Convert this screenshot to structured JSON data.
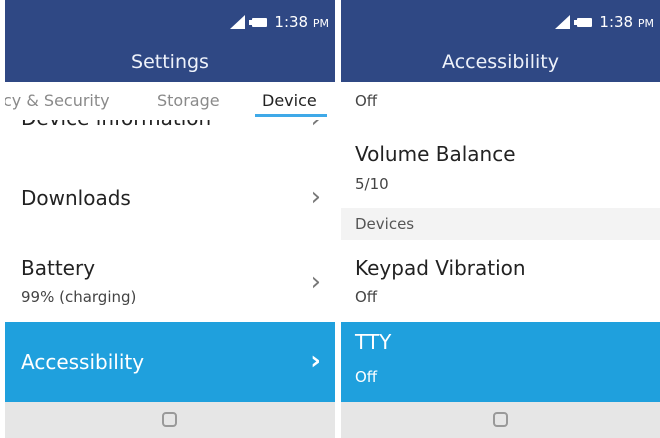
{
  "left": {
    "status": {
      "time": "1:38",
      "ampm": "PM"
    },
    "header": {
      "title": "Settings"
    },
    "tabs": [
      {
        "label": "cy & Security"
      },
      {
        "label": "Storage"
      },
      {
        "label": "Device"
      }
    ],
    "items": [
      {
        "title": "Device information"
      },
      {
        "title": "Downloads"
      },
      {
        "title": "Battery",
        "sub": "99% (charging)"
      },
      {
        "title": "Accessibility"
      }
    ],
    "chevron": "›"
  },
  "right": {
    "status": {
      "time": "1:38",
      "ampm": "PM"
    },
    "header": {
      "title": "Accessibility"
    },
    "items": [
      {
        "sub": "Off"
      },
      {
        "title": "Volume Balance",
        "sub": "5/10"
      },
      {
        "title": "Keypad Vibration",
        "sub": "Off"
      },
      {
        "title": "TTY",
        "sub": "Off"
      }
    ],
    "section": {
      "label": "Devices"
    }
  },
  "colors": {
    "header": "#2f4884",
    "selected": "#1fa0dd",
    "tab_underline": "#3fa9e8",
    "softkey_bar": "#e6e6e6"
  },
  "icons": [
    "signal-icon",
    "battery-icon",
    "chevron-right-icon",
    "home-button-icon"
  ]
}
